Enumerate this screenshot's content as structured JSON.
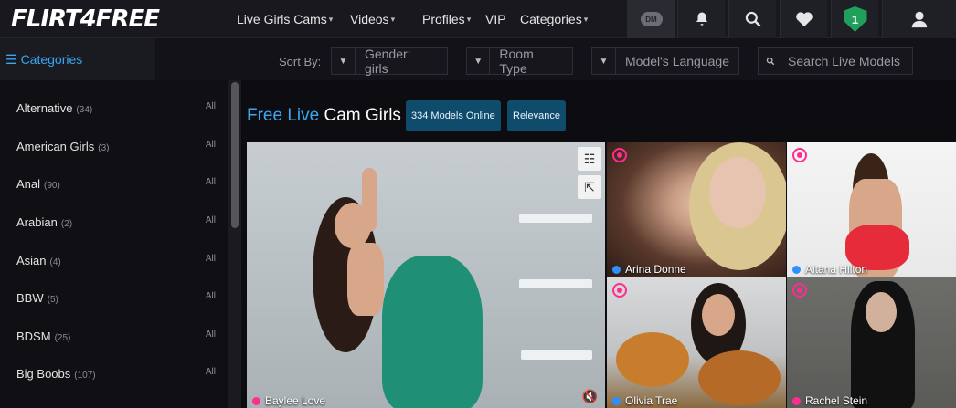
{
  "header": {
    "logo": "FLIRT4FREE",
    "nav": [
      {
        "label": "Live Girls Cams",
        "chevron": true
      },
      {
        "label": "Videos",
        "chevron": true
      },
      {
        "label": "Profiles",
        "chevron": true
      },
      {
        "label": "VIP",
        "chevron": false
      },
      {
        "label": "Categories",
        "chevron": true
      }
    ],
    "icons": [
      "dm-icon",
      "bell-icon",
      "search-icon",
      "heart-icon",
      "shield-badge-icon",
      "user-icon"
    ],
    "dm_label": "DM",
    "badge_count": "1"
  },
  "sortbar": {
    "categories_label": "Categories",
    "sort_by_label": "Sort By:",
    "gender_select": "Gender: girls",
    "room_type_select": "Room Type",
    "language_select": "Model's Language",
    "search_placeholder": "Search Live Models"
  },
  "sidebar": {
    "categories": [
      {
        "name": "Alternative",
        "count": "(34)",
        "all": "All"
      },
      {
        "name": "American Girls",
        "count": "(3)",
        "all": "All"
      },
      {
        "name": "Anal",
        "count": "(90)",
        "all": "All"
      },
      {
        "name": "Arabian",
        "count": "(2)",
        "all": "All"
      },
      {
        "name": "Asian",
        "count": "(4)",
        "all": "All"
      },
      {
        "name": "BBW",
        "count": "(5)",
        "all": "All"
      },
      {
        "name": "BDSM",
        "count": "(25)",
        "all": "All"
      },
      {
        "name": "Big Boobs",
        "count": "(107)",
        "all": "All"
      }
    ]
  },
  "main": {
    "title_blue": "Free Live",
    "title_white": "Cam Girls",
    "models_online": "334 Models Online",
    "relevance": "Relevance",
    "models": [
      {
        "name": "Baylee Love",
        "dot": "#ff2d8f"
      },
      {
        "name": "Arina Donne",
        "dot": "#2e8fff"
      },
      {
        "name": "Aitana Hilton",
        "dot": "#2e8fff"
      },
      {
        "name": "Olivia Trae",
        "dot": "#2e8fff"
      },
      {
        "name": "Rachel Stein",
        "dot": "#ff2d8f"
      }
    ]
  },
  "colors": {
    "accent_blue": "#3aa7f0",
    "live_pink": "#ff2d8f",
    "pill_bg": "#0f4b6a"
  }
}
